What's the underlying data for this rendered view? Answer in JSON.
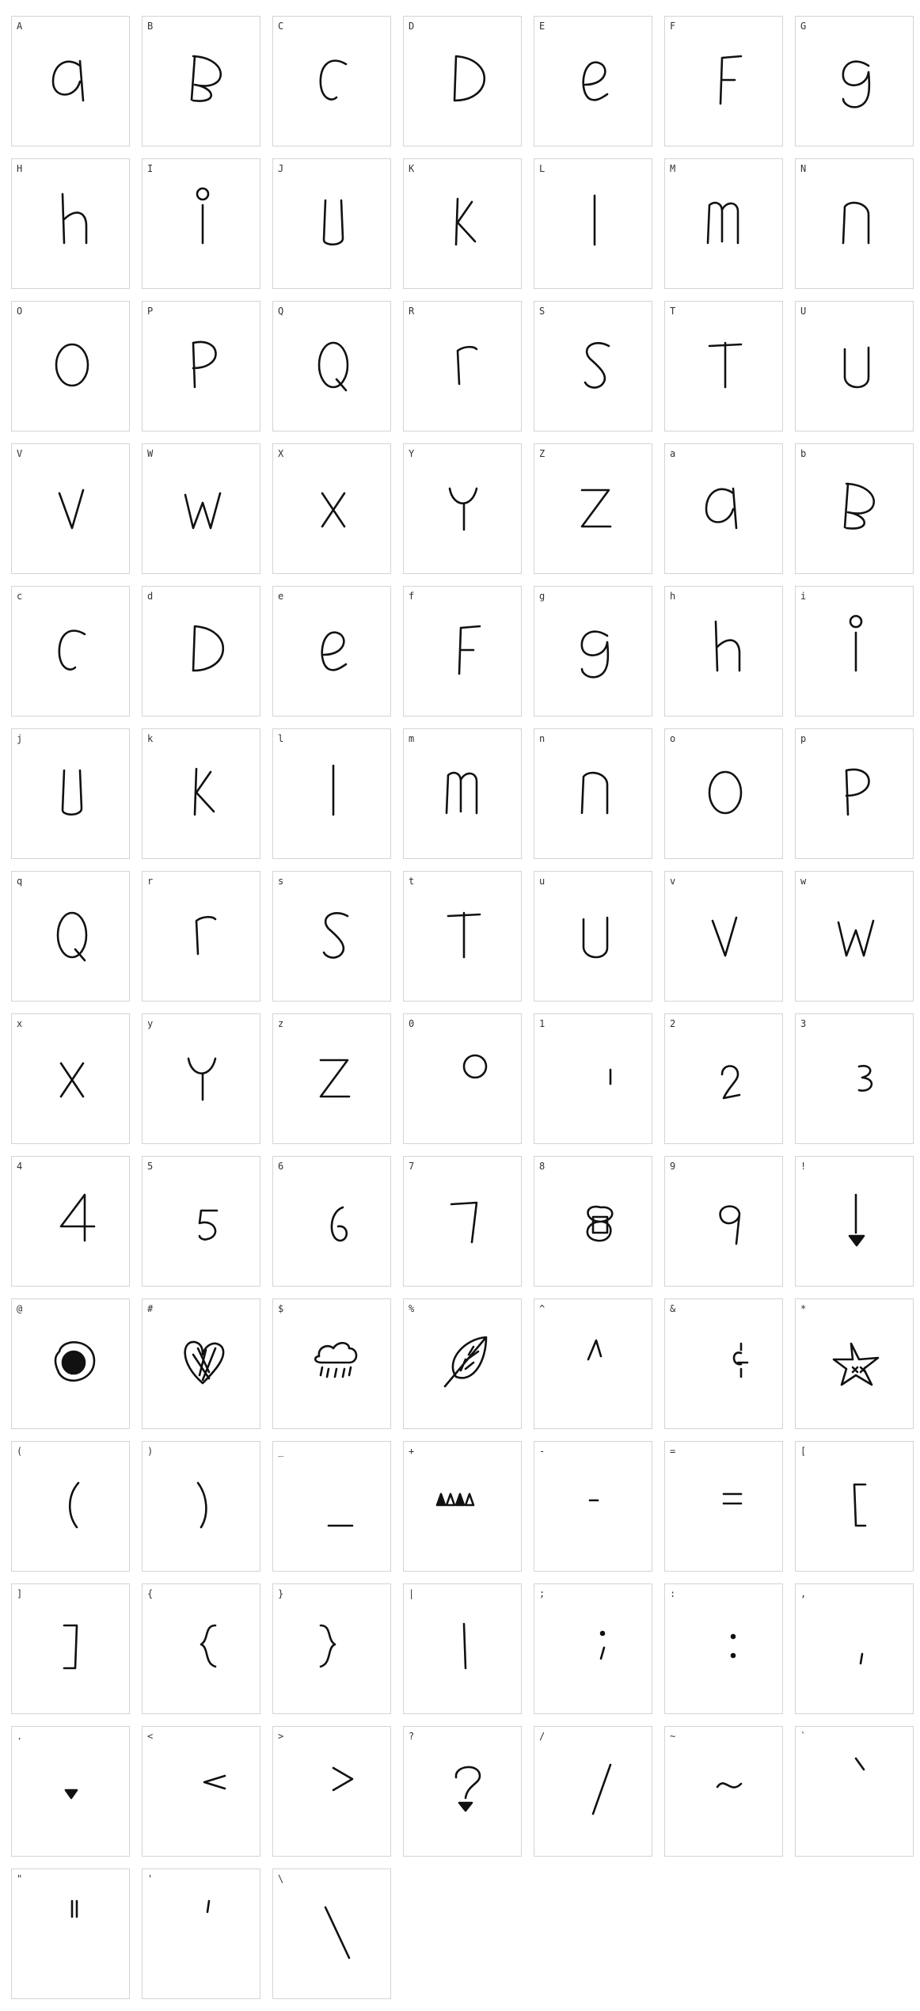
{
  "grid": {
    "columns": 7,
    "stroke_color": "#111111",
    "border_color": "#d4d4d4",
    "cells": [
      "A",
      "B",
      "C",
      "D",
      "E",
      "F",
      "G",
      "H",
      "I",
      "J",
      "K",
      "L",
      "M",
      "N",
      "O",
      "P",
      "Q",
      "R",
      "S",
      "T",
      "U",
      "V",
      "W",
      "X",
      "Y",
      "Z",
      "a",
      "b",
      "c",
      "d",
      "e",
      "f",
      "g",
      "h",
      "i",
      "j",
      "k",
      "l",
      "m",
      "n",
      "o",
      "p",
      "q",
      "r",
      "s",
      "t",
      "u",
      "v",
      "w",
      "x",
      "y",
      "z",
      "0",
      "1",
      "2",
      "3",
      "4",
      "5",
      "6",
      "7",
      "8",
      "9",
      "!",
      "@",
      "#",
      "$",
      "%",
      "^",
      "&",
      "*",
      "(",
      ")",
      "_",
      "+",
      "-",
      "=",
      "[",
      "]",
      "{",
      "}",
      "|",
      ";",
      ":",
      ",",
      ".",
      "<",
      ">",
      "?",
      "/",
      "~",
      "`",
      "\"",
      "'",
      "\\"
    ]
  }
}
